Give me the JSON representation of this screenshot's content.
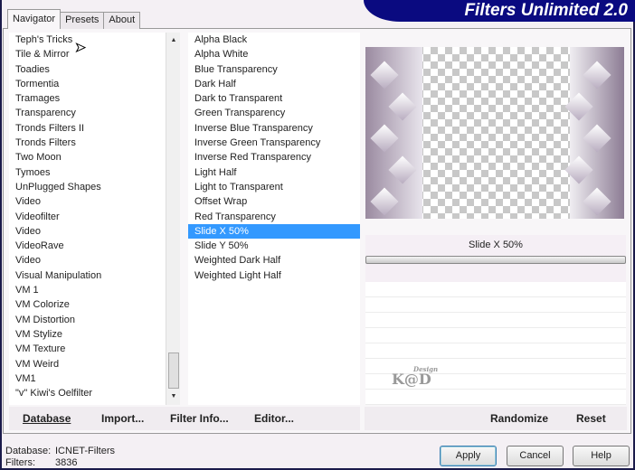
{
  "title": "Filters Unlimited 2.0",
  "tabs": [
    "Navigator",
    "Presets",
    "About"
  ],
  "categories": [
    "Teph's Tricks",
    "Tile & Mirror",
    "Toadies",
    "Tormentia",
    "Tramages",
    "Transparency",
    "Tronds Filters II",
    "Tronds Filters",
    "Two Moon",
    "Tymoes",
    "UnPlugged Shapes",
    "Video",
    "Videofilter",
    "Video",
    "VideoRave",
    "Video",
    "Visual Manipulation",
    "VM 1",
    "VM Colorize",
    "VM Distortion",
    "VM Stylize",
    "VM Texture",
    "VM Weird",
    "VM1",
    "\"v\" Kiwi's Oelfilter"
  ],
  "filters": [
    "Alpha Black",
    "Alpha White",
    "Blue Transparency",
    "Dark Half",
    "Dark to Transparent",
    "Green Transparency",
    "Inverse Blue Transparency",
    "Inverse Green Transparency",
    "Inverse Red Transparency",
    "Light Half",
    "Light to Transparent",
    "Offset Wrap",
    "Red Transparency",
    "Slide X 50%",
    "Slide Y 50%",
    "Weighted Dark Half",
    "Weighted Light Half"
  ],
  "selected_filter": "Slide X 50%",
  "preview": {
    "filter_label": "Slide X 50%",
    "watermark": "K@D",
    "watermark_small": "Design"
  },
  "buttons": {
    "database": "Database",
    "import": "Import...",
    "filter_info": "Filter Info...",
    "editor": "Editor...",
    "randomize": "Randomize",
    "reset": "Reset",
    "apply": "Apply",
    "cancel": "Cancel",
    "help": "Help"
  },
  "status": {
    "database_label": "Database:",
    "database_value": "ICNET-Filters",
    "filters_label": "Filters:",
    "filters_value": "3836"
  },
  "colors": {
    "selection": "#3399ff",
    "banner": "#0a0a80"
  }
}
